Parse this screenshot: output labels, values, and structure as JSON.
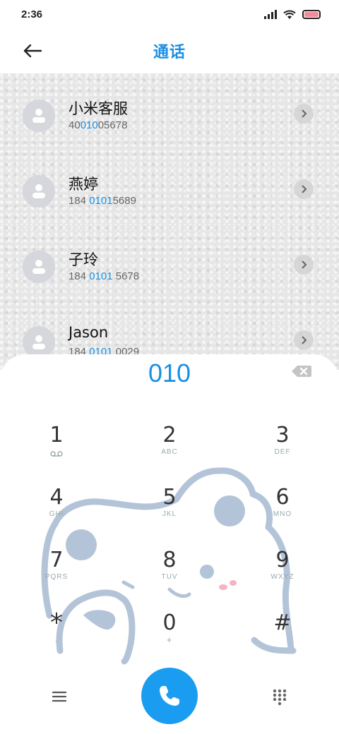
{
  "status": {
    "time": "2:36"
  },
  "header": {
    "title": "通话"
  },
  "contacts": [
    {
      "name": "小米客服",
      "num_pre": "40",
      "num_hl": "010",
      "num_post": "05678"
    },
    {
      "name": "燕婷",
      "num_pre": "184 ",
      "num_hl": "0101",
      "num_post": "5689"
    },
    {
      "name": "子玲",
      "num_pre": "184 ",
      "num_hl": "0101",
      "num_post": " 5678"
    },
    {
      "name": "Jason",
      "num_pre": "184 ",
      "num_hl": "0101",
      "num_post": " 0029"
    }
  ],
  "dialer": {
    "entered": "010",
    "keys": [
      {
        "digit": "1",
        "sub": ""
      },
      {
        "digit": "2",
        "sub": "ABC"
      },
      {
        "digit": "3",
        "sub": "DEF"
      },
      {
        "digit": "4",
        "sub": "GHI"
      },
      {
        "digit": "5",
        "sub": "JKL"
      },
      {
        "digit": "6",
        "sub": "MNO"
      },
      {
        "digit": "7",
        "sub": "PQRS"
      },
      {
        "digit": "8",
        "sub": "TUV"
      },
      {
        "digit": "9",
        "sub": "WXYZ"
      },
      {
        "digit": "*",
        "sub": ","
      },
      {
        "digit": "0",
        "sub": "+"
      },
      {
        "digit": "#",
        "sub": ""
      }
    ]
  },
  "colors": {
    "accent": "#1a8fe3",
    "call": "#1a9df0",
    "bear": "#b4c4d8"
  },
  "icons": [
    "back-arrow-icon",
    "avatar-person-icon",
    "chevron-right-icon",
    "backspace-icon",
    "voicemail-icon",
    "menu-icon",
    "phone-icon",
    "keypad-icon"
  ]
}
